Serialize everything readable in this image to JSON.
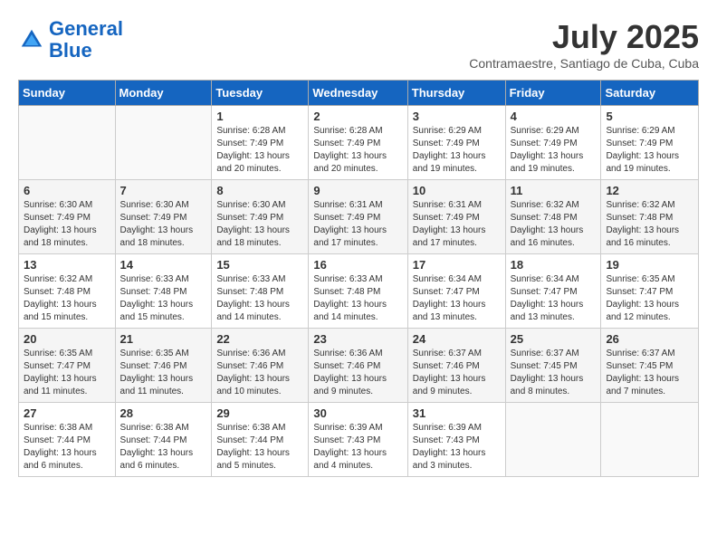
{
  "header": {
    "logo_line1": "General",
    "logo_line2": "Blue",
    "month_title": "July 2025",
    "location": "Contramaestre, Santiago de Cuba, Cuba"
  },
  "weekdays": [
    "Sunday",
    "Monday",
    "Tuesday",
    "Wednesday",
    "Thursday",
    "Friday",
    "Saturday"
  ],
  "weeks": [
    [
      {
        "day": "",
        "info": ""
      },
      {
        "day": "",
        "info": ""
      },
      {
        "day": "1",
        "info": "Sunrise: 6:28 AM\nSunset: 7:49 PM\nDaylight: 13 hours\nand 20 minutes."
      },
      {
        "day": "2",
        "info": "Sunrise: 6:28 AM\nSunset: 7:49 PM\nDaylight: 13 hours\nand 20 minutes."
      },
      {
        "day": "3",
        "info": "Sunrise: 6:29 AM\nSunset: 7:49 PM\nDaylight: 13 hours\nand 19 minutes."
      },
      {
        "day": "4",
        "info": "Sunrise: 6:29 AM\nSunset: 7:49 PM\nDaylight: 13 hours\nand 19 minutes."
      },
      {
        "day": "5",
        "info": "Sunrise: 6:29 AM\nSunset: 7:49 PM\nDaylight: 13 hours\nand 19 minutes."
      }
    ],
    [
      {
        "day": "6",
        "info": "Sunrise: 6:30 AM\nSunset: 7:49 PM\nDaylight: 13 hours\nand 18 minutes."
      },
      {
        "day": "7",
        "info": "Sunrise: 6:30 AM\nSunset: 7:49 PM\nDaylight: 13 hours\nand 18 minutes."
      },
      {
        "day": "8",
        "info": "Sunrise: 6:30 AM\nSunset: 7:49 PM\nDaylight: 13 hours\nand 18 minutes."
      },
      {
        "day": "9",
        "info": "Sunrise: 6:31 AM\nSunset: 7:49 PM\nDaylight: 13 hours\nand 17 minutes."
      },
      {
        "day": "10",
        "info": "Sunrise: 6:31 AM\nSunset: 7:49 PM\nDaylight: 13 hours\nand 17 minutes."
      },
      {
        "day": "11",
        "info": "Sunrise: 6:32 AM\nSunset: 7:48 PM\nDaylight: 13 hours\nand 16 minutes."
      },
      {
        "day": "12",
        "info": "Sunrise: 6:32 AM\nSunset: 7:48 PM\nDaylight: 13 hours\nand 16 minutes."
      }
    ],
    [
      {
        "day": "13",
        "info": "Sunrise: 6:32 AM\nSunset: 7:48 PM\nDaylight: 13 hours\nand 15 minutes."
      },
      {
        "day": "14",
        "info": "Sunrise: 6:33 AM\nSunset: 7:48 PM\nDaylight: 13 hours\nand 15 minutes."
      },
      {
        "day": "15",
        "info": "Sunrise: 6:33 AM\nSunset: 7:48 PM\nDaylight: 13 hours\nand 14 minutes."
      },
      {
        "day": "16",
        "info": "Sunrise: 6:33 AM\nSunset: 7:48 PM\nDaylight: 13 hours\nand 14 minutes."
      },
      {
        "day": "17",
        "info": "Sunrise: 6:34 AM\nSunset: 7:47 PM\nDaylight: 13 hours\nand 13 minutes."
      },
      {
        "day": "18",
        "info": "Sunrise: 6:34 AM\nSunset: 7:47 PM\nDaylight: 13 hours\nand 13 minutes."
      },
      {
        "day": "19",
        "info": "Sunrise: 6:35 AM\nSunset: 7:47 PM\nDaylight: 13 hours\nand 12 minutes."
      }
    ],
    [
      {
        "day": "20",
        "info": "Sunrise: 6:35 AM\nSunset: 7:47 PM\nDaylight: 13 hours\nand 11 minutes."
      },
      {
        "day": "21",
        "info": "Sunrise: 6:35 AM\nSunset: 7:46 PM\nDaylight: 13 hours\nand 11 minutes."
      },
      {
        "day": "22",
        "info": "Sunrise: 6:36 AM\nSunset: 7:46 PM\nDaylight: 13 hours\nand 10 minutes."
      },
      {
        "day": "23",
        "info": "Sunrise: 6:36 AM\nSunset: 7:46 PM\nDaylight: 13 hours\nand 9 minutes."
      },
      {
        "day": "24",
        "info": "Sunrise: 6:37 AM\nSunset: 7:46 PM\nDaylight: 13 hours\nand 9 minutes."
      },
      {
        "day": "25",
        "info": "Sunrise: 6:37 AM\nSunset: 7:45 PM\nDaylight: 13 hours\nand 8 minutes."
      },
      {
        "day": "26",
        "info": "Sunrise: 6:37 AM\nSunset: 7:45 PM\nDaylight: 13 hours\nand 7 minutes."
      }
    ],
    [
      {
        "day": "27",
        "info": "Sunrise: 6:38 AM\nSunset: 7:44 PM\nDaylight: 13 hours\nand 6 minutes."
      },
      {
        "day": "28",
        "info": "Sunrise: 6:38 AM\nSunset: 7:44 PM\nDaylight: 13 hours\nand 6 minutes."
      },
      {
        "day": "29",
        "info": "Sunrise: 6:38 AM\nSunset: 7:44 PM\nDaylight: 13 hours\nand 5 minutes."
      },
      {
        "day": "30",
        "info": "Sunrise: 6:39 AM\nSunset: 7:43 PM\nDaylight: 13 hours\nand 4 minutes."
      },
      {
        "day": "31",
        "info": "Sunrise: 6:39 AM\nSunset: 7:43 PM\nDaylight: 13 hours\nand 3 minutes."
      },
      {
        "day": "",
        "info": ""
      },
      {
        "day": "",
        "info": ""
      }
    ]
  ]
}
